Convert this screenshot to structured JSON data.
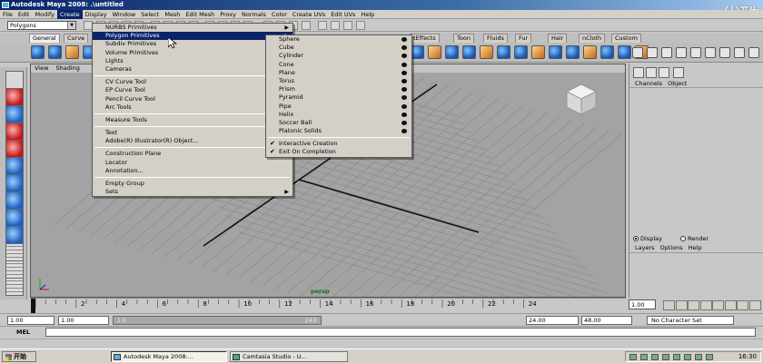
{
  "window": {
    "title": "Autodesk Maya 2008: .\\untitled"
  },
  "watermark": "优酷",
  "menubar": [
    "File",
    "Edit",
    "Modify",
    "Create",
    "Display",
    "Window",
    "Select",
    "Mesh",
    "Edit Mesh",
    "Proxy",
    "Normals",
    "Color",
    "Create UVs",
    "Edit UVs",
    "Help"
  ],
  "status_line": {
    "mode": "Polygons"
  },
  "shelf_tabs": [
    "General",
    "Curve",
    "tEffects",
    "Toon",
    "Fluids",
    "Fur",
    "Hair",
    "nCloth",
    "Custom"
  ],
  "panel_menu": [
    "View",
    "Shading"
  ],
  "viewport_label": "persp",
  "create_menu": [
    {
      "label": "NURBS Primitives",
      "submenu": true
    },
    {
      "label": "Polygon Primitives",
      "submenu": true,
      "highlighted": true
    },
    {
      "label": "Subdiv Primitives",
      "submenu": true
    },
    {
      "label": "Volume Primitives",
      "submenu": true
    },
    {
      "label": "Lights",
      "submenu": true
    },
    {
      "label": "Cameras",
      "submenu": true
    },
    {
      "separator": true
    },
    {
      "label": "CV Curve Tool"
    },
    {
      "label": "EP Curve Tool"
    },
    {
      "label": "Pencil Curve Tool"
    },
    {
      "label": "Arc Tools",
      "submenu": true
    },
    {
      "separator": true
    },
    {
      "label": "Measure Tools",
      "submenu": true
    },
    {
      "separator": true
    },
    {
      "label": "Text"
    },
    {
      "label": "Adobe(R) Illustrator(R) Object..."
    },
    {
      "separator": true
    },
    {
      "label": "Construction Plane"
    },
    {
      "label": "Locator"
    },
    {
      "label": "Annotation..."
    },
    {
      "separator": true
    },
    {
      "label": "Empty Group"
    },
    {
      "label": "Sets",
      "submenu": true
    }
  ],
  "polygon_submenu": [
    {
      "label": "Sphere",
      "option": true
    },
    {
      "label": "Cube",
      "option": true
    },
    {
      "label": "Cylinder",
      "option": true
    },
    {
      "label": "Cone",
      "option": true
    },
    {
      "label": "Plane",
      "option": true
    },
    {
      "label": "Torus",
      "option": true
    },
    {
      "label": "Prism",
      "option": true
    },
    {
      "label": "Pyramid",
      "option": true
    },
    {
      "label": "Pipe",
      "option": true
    },
    {
      "label": "Helix",
      "option": true
    },
    {
      "label": "Soccer Ball",
      "option": true
    },
    {
      "label": "Platonic Solids",
      "option": true
    },
    {
      "separator": true
    },
    {
      "label": "Interactive Creation",
      "checked": true
    },
    {
      "label": "Exit On Completion",
      "checked": true
    }
  ],
  "channel_box": {
    "header": [
      "Channels",
      "Object"
    ]
  },
  "layer_editor": {
    "radio": [
      {
        "label": "Display",
        "selected": true
      },
      {
        "label": "Render",
        "selected": false
      }
    ],
    "menu": [
      "Layers",
      "Options",
      "Help"
    ]
  },
  "time_slider": {
    "ticks": [
      "2",
      "4",
      "6",
      "8",
      "10",
      "12",
      "14",
      "16",
      "18",
      "20",
      "22",
      "24"
    ],
    "current_frame": "1.00"
  },
  "range_slider": {
    "start": "1.00",
    "start2": "1.00",
    "bar_start": "1.0",
    "bar_end": "24.0",
    "end": "24.00",
    "end2": "48.00",
    "character_set": "No Character Set"
  },
  "command_line": {
    "label": "MEL"
  },
  "taskbar": {
    "start": "开始",
    "tasks": [
      {
        "label": "Autodesk Maya 2008:...",
        "active": true
      },
      {
        "label": "Camtasia Studio - U..."
      }
    ],
    "clock": "16:30"
  },
  "colors": {
    "highlight": "#0a246a",
    "viewport_bg": "#a3a3a3",
    "grid": "#8b8b8b",
    "persp_label": "#1a6a1a"
  }
}
